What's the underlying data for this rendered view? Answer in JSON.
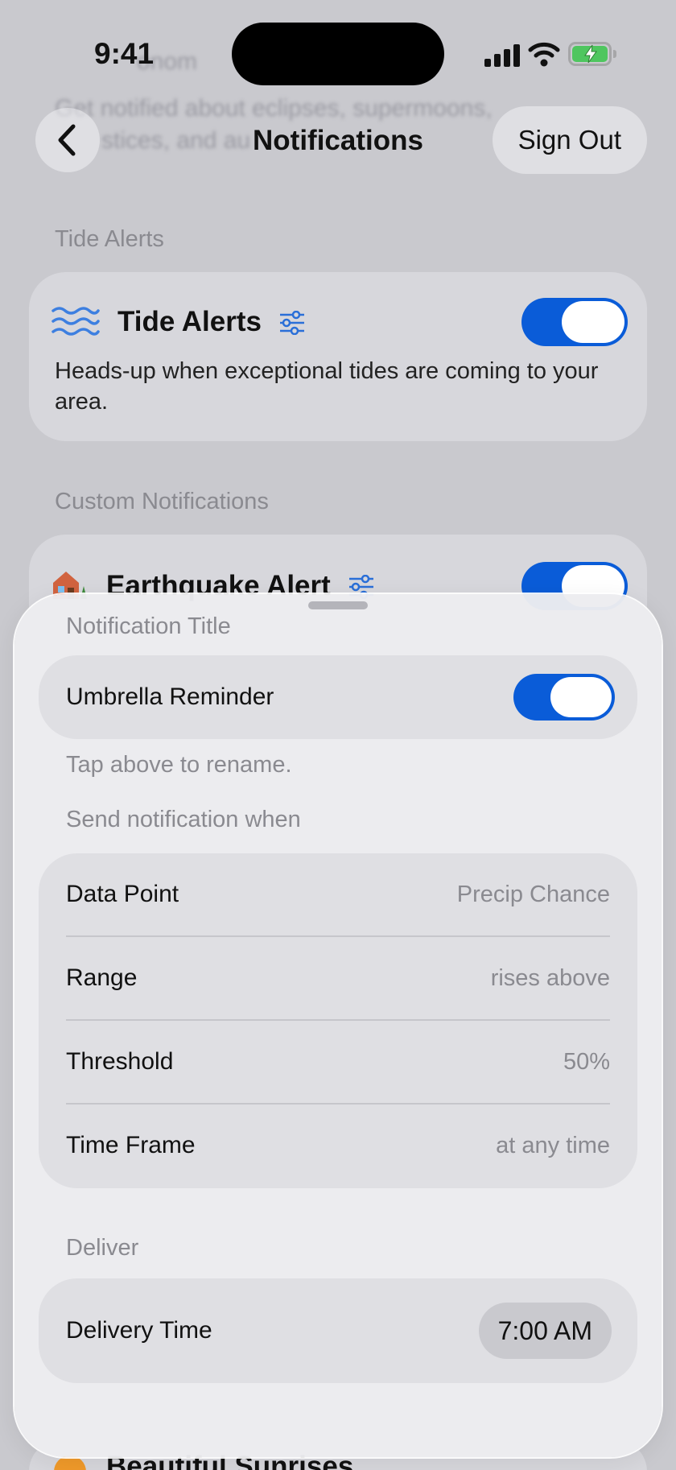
{
  "status_bar": {
    "time": "9:41"
  },
  "nav": {
    "title": "Notifications",
    "right_label": "Sign Out"
  },
  "background": {
    "ghost_lines": [
      "Get notified about eclipses, supermoons,",
      "stices, and au"
    ],
    "tide_section": {
      "header": "Tide Alerts",
      "card_title": "Tide Alerts",
      "description": "Heads-up when exceptional tides are coming to your area.",
      "toggle_on": true
    },
    "custom_section": {
      "header": "Custom Notifications",
      "card_title": "Earthquake Alert",
      "toggle_on": true
    },
    "bottom_card_title": "Beautiful Sunrises"
  },
  "sheet": {
    "title_label": "Notification Title",
    "title_value": "Umbrella Reminder",
    "title_toggle_on": true,
    "rename_hint": "Tap above to rename.",
    "send_when_label": "Send notification when",
    "conditions": [
      {
        "label": "Data Point",
        "value": "Precip Chance"
      },
      {
        "label": "Range",
        "value": "rises above"
      },
      {
        "label": "Threshold",
        "value": "50%"
      },
      {
        "label": "Time Frame",
        "value": "at any time"
      }
    ],
    "deliver_label": "Deliver",
    "delivery_time_label": "Delivery Time",
    "delivery_time_value": "7:00 AM"
  },
  "colors": {
    "accent": "#0a5cd8",
    "battery": "#4fc65f",
    "secondary_text": "#8a8a90"
  },
  "icons": [
    "back-chevron-icon",
    "cellular-signal-icon",
    "wifi-icon",
    "battery-icon",
    "waves-icon",
    "sliders-icon",
    "house-icon",
    "sunrise-icon"
  ]
}
